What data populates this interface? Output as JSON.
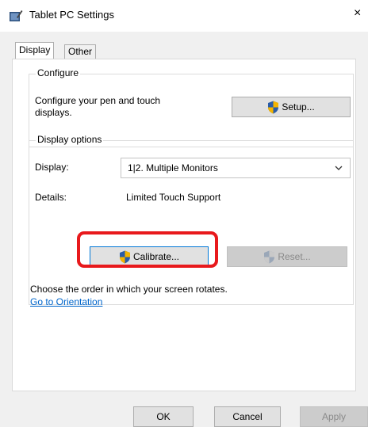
{
  "window": {
    "title": "Tablet PC Settings",
    "close_glyph": "×"
  },
  "tabs": [
    {
      "label": "Display",
      "selected": true
    },
    {
      "label": "Other",
      "selected": false
    }
  ],
  "configure": {
    "group_label": "Configure",
    "description": "Configure your pen and touch\ndisplays.",
    "setup_button": "Setup..."
  },
  "display_options": {
    "group_label": "Display options",
    "display_label": "Display:",
    "display_value": "1|2. Multiple Monitors",
    "details_label": "Details:",
    "details_value": "Limited Touch Support",
    "calibrate_button": "Calibrate...",
    "reset_button": "Reset..."
  },
  "orientation": {
    "text": "Choose the order in which your screen rotates.",
    "link": "Go to Orientation"
  },
  "footer": {
    "ok": "OK",
    "cancel": "Cancel",
    "apply": "Apply"
  },
  "colors": {
    "highlight": "#e8191c",
    "link": "#0066cc",
    "button_bg": "#e1e1e1"
  },
  "icons": [
    "tablet-pen-icon",
    "close-icon",
    "uac-shield-icon",
    "chevron-down-icon"
  ]
}
